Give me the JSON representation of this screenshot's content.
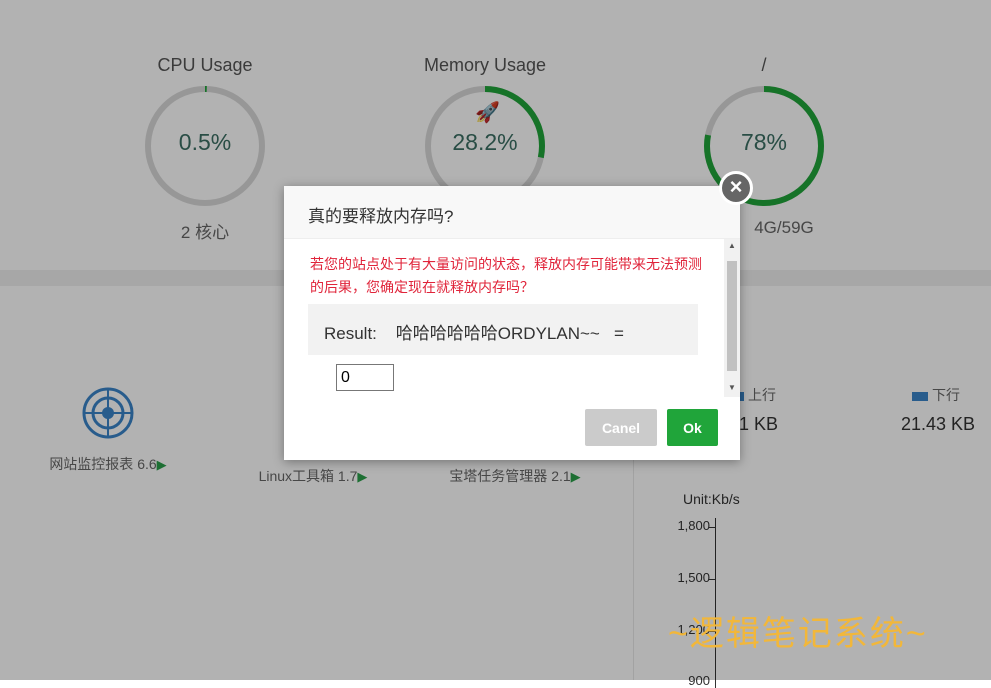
{
  "gauges": {
    "cpu": {
      "title": "CPU Usage",
      "value": "0.5%",
      "sub": "2 核心",
      "percent": 0.5,
      "color": "#20a53a"
    },
    "memory": {
      "title": "Memory Usage",
      "value": "28.2%",
      "icon": "rocket-icon",
      "percent": 28.2,
      "color": "#20a53a"
    },
    "disk": {
      "title": "/",
      "value": "78%",
      "sub": "4G/59G",
      "percent": 78,
      "color": "#20a53a"
    }
  },
  "software": [
    {
      "label": "网站监控报表 6.6",
      "icon": "radar-icon"
    },
    {
      "label": "Linux工具箱 1.7"
    },
    {
      "label": "宝塔任务管理器 2.1"
    }
  ],
  "network": {
    "upstream_label": "上行",
    "upstream_value": "1 KB",
    "downstream_label": "下行",
    "downstream_value": "21.43 KB",
    "unit": "Unit:Kb/s",
    "y_ticks": [
      "1,800",
      "1,500",
      "1,200",
      "900"
    ]
  },
  "dialog": {
    "title": "真的要释放内存吗?",
    "warning": "若您的站点处于有大量访问的状态，释放内存可能带来无法预测的后果，您确定现在就释放内存吗？",
    "result_text": "Result:    哈哈哈哈哈哈ORDYLAN~~   =",
    "answer_value": "0",
    "cancel_label": "Canel",
    "ok_label": "Ok",
    "close_symbol": "×"
  },
  "watermark": "~逻辑笔记系统~",
  "colors": {
    "accent": "#20a53a",
    "warning": "#e0243a",
    "legend": "#3a84c9"
  }
}
